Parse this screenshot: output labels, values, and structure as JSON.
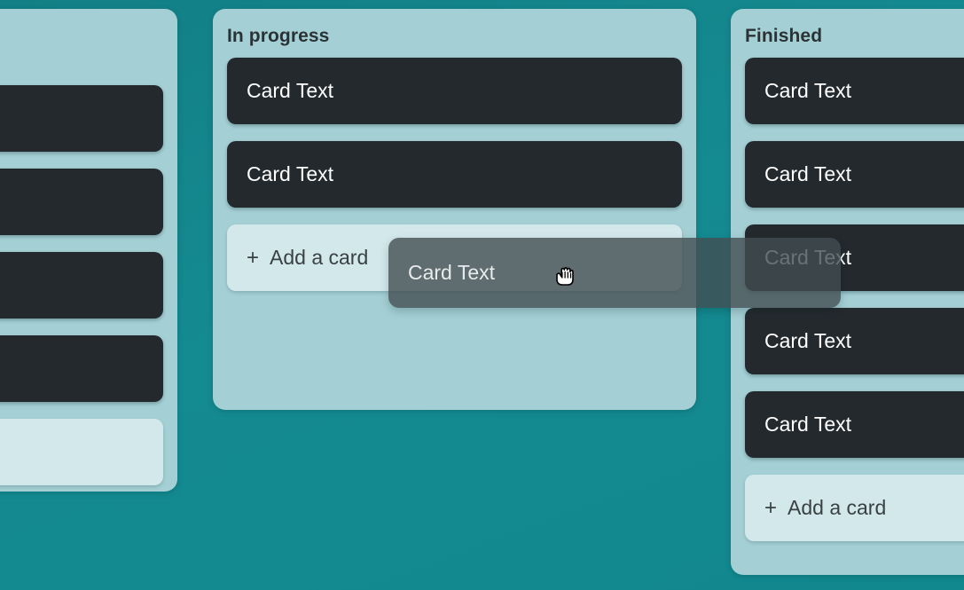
{
  "board": {
    "background_color": "#148a90",
    "column_color": "#a4d0d5",
    "card_color": "#24292d",
    "add_card_color": "#d3e8eb",
    "card_text_color": "#ffffff",
    "title_text_color": "#2b3236"
  },
  "columns": [
    {
      "id": "backlog",
      "title": "",
      "cards": [
        {
          "text": ""
        },
        {
          "text": ""
        },
        {
          "text": ""
        },
        {
          "text": ""
        }
      ],
      "add_card": {
        "plus": "+",
        "label": ""
      }
    },
    {
      "id": "inprogress",
      "title": "In progress",
      "cards": [
        {
          "text": "Card Text"
        },
        {
          "text": "Card Text"
        }
      ],
      "add_card": {
        "plus": "+",
        "label": "Add a card"
      }
    },
    {
      "id": "finished",
      "title": "Finished",
      "cards": [
        {
          "text": "Card Text"
        },
        {
          "text": "Card Text"
        },
        {
          "text": "Card Text"
        },
        {
          "text": "Card Text"
        },
        {
          "text": "Card Text"
        }
      ],
      "add_card": {
        "plus": "+",
        "label": "Add a card"
      }
    }
  ],
  "drag": {
    "card_text": "Card Text",
    "overlay_color": "#424d51",
    "cursor_icon": "grabbing-hand-cursor"
  }
}
